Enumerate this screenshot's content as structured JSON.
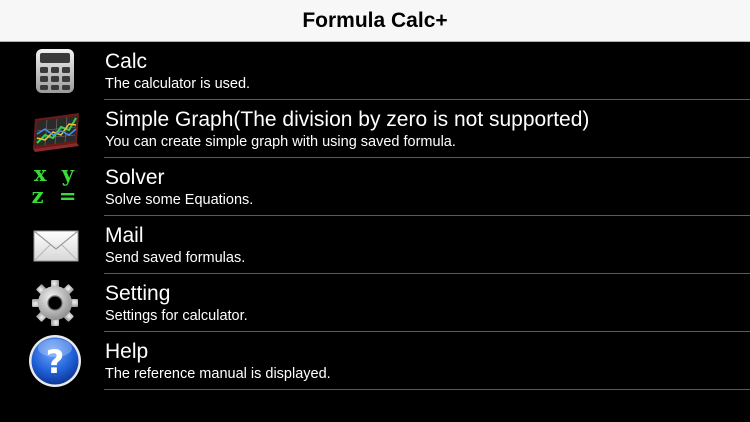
{
  "header": {
    "title": "Formula Calc+"
  },
  "menu": {
    "items": [
      {
        "icon": "calculator-icon",
        "title": "Calc",
        "subtitle": "The calculator is used."
      },
      {
        "icon": "graph-icon",
        "title": "Simple Graph(The division by zero is not supported)",
        "subtitle": "You can create simple graph with using saved formula."
      },
      {
        "icon": "xyz-icon",
        "title": "Solver",
        "subtitle": "Solve some Equations.",
        "icon_text": [
          "x y",
          "z ="
        ]
      },
      {
        "icon": "mail-icon",
        "title": "Mail",
        "subtitle": "Send saved formulas."
      },
      {
        "icon": "gear-icon",
        "title": "Setting",
        "subtitle": "Settings for calculator."
      },
      {
        "icon": "help-icon",
        "title": "Help",
        "subtitle": "The reference manual is displayed.",
        "icon_text": "?"
      }
    ]
  },
  "colors": {
    "background": "#000000",
    "navbar": "#f7f7f7",
    "solver_green": "#3adc3a",
    "help_blue": "#1f5fd6"
  }
}
